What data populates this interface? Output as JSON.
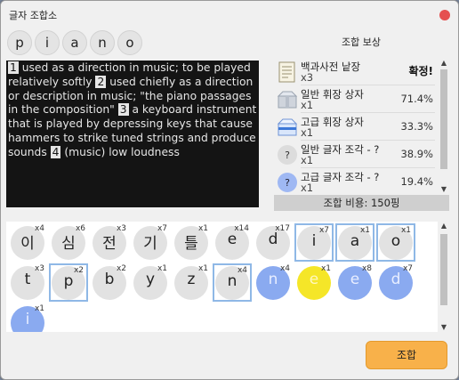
{
  "window": {
    "title": "글자 조합소"
  },
  "word_letters": [
    "p",
    "i",
    "a",
    "n",
    "o"
  ],
  "rewards_title": "조합 보상",
  "definition": {
    "segments": [
      {
        "n": "1",
        "text": " used as a direction in music; to be played relatively softly "
      },
      {
        "n": "2",
        "text": " used chiefly as a direction or description in music; \"the piano passages in the composition\" "
      },
      {
        "n": "3",
        "text": " a keyboard instrument that is played by depressing keys that cause hammers to strike tuned strings and produce sounds "
      },
      {
        "n": "4",
        "text": " (music) low loudness"
      }
    ]
  },
  "rewards": [
    {
      "name": "백과사전 낱장",
      "count": "x3",
      "status": "확정!",
      "icon": "encyclopedia-page-icon"
    },
    {
      "name": "일반 휘장 상자",
      "count": "x1",
      "pct": "71.4%",
      "icon": "common-emblem-box-icon"
    },
    {
      "name": "고급 휘장 상자",
      "count": "x1",
      "pct": "33.3%",
      "icon": "premium-emblem-box-icon"
    },
    {
      "name": "일반 글자 조각 - ?",
      "count": "x1",
      "pct": "38.9%",
      "icon": "common-letter-piece-icon"
    },
    {
      "name": "고급 글자 조각 - ?",
      "count": "x1",
      "pct": "19.4%",
      "icon": "premium-letter-piece-icon"
    }
  ],
  "cost_label": "조합 비용: 150핑",
  "tiles": [
    {
      "letter": "이",
      "count": "x4",
      "selected": false,
      "color": "gray"
    },
    {
      "letter": "심",
      "count": "x6",
      "selected": false,
      "color": "gray"
    },
    {
      "letter": "전",
      "count": "x3",
      "selected": false,
      "color": "gray"
    },
    {
      "letter": "기",
      "count": "x7",
      "selected": false,
      "color": "gray"
    },
    {
      "letter": "틀",
      "count": "x1",
      "selected": false,
      "color": "gray"
    },
    {
      "letter": "e",
      "count": "x14",
      "selected": false,
      "color": "gray"
    },
    {
      "letter": "d",
      "count": "x17",
      "selected": false,
      "color": "gray"
    },
    {
      "letter": "i",
      "count": "x7",
      "selected": true,
      "color": "gray"
    },
    {
      "letter": "a",
      "count": "x1",
      "selected": true,
      "color": "gray"
    },
    {
      "letter": "o",
      "count": "x1",
      "selected": true,
      "color": "gray"
    },
    {
      "letter": "t",
      "count": "x3",
      "selected": false,
      "color": "gray"
    },
    {
      "letter": "p",
      "count": "x2",
      "selected": true,
      "color": "gray"
    },
    {
      "letter": "b",
      "count": "x2",
      "selected": false,
      "color": "gray"
    },
    {
      "letter": "y",
      "count": "x1",
      "selected": false,
      "color": "gray"
    },
    {
      "letter": "z",
      "count": "x1",
      "selected": false,
      "color": "gray"
    },
    {
      "letter": "n",
      "count": "x4",
      "selected": true,
      "color": "gray"
    },
    {
      "letter": "n",
      "count": "x4",
      "selected": false,
      "color": "blue"
    },
    {
      "letter": "e",
      "count": "x1",
      "selected": false,
      "color": "yellow"
    },
    {
      "letter": "e",
      "count": "x8",
      "selected": false,
      "color": "blue"
    },
    {
      "letter": "d",
      "count": "x7",
      "selected": false,
      "color": "blue"
    },
    {
      "letter": "i",
      "count": "x1",
      "selected": false,
      "color": "blue"
    }
  ],
  "combine_label": "조합",
  "colors": {
    "accent_button": "#f8b14a",
    "selected_border": "#8fb8e6",
    "blue_tile": "#8aaaf0",
    "yellow_tile": "#f5e628",
    "definition_bg": "#141414"
  }
}
